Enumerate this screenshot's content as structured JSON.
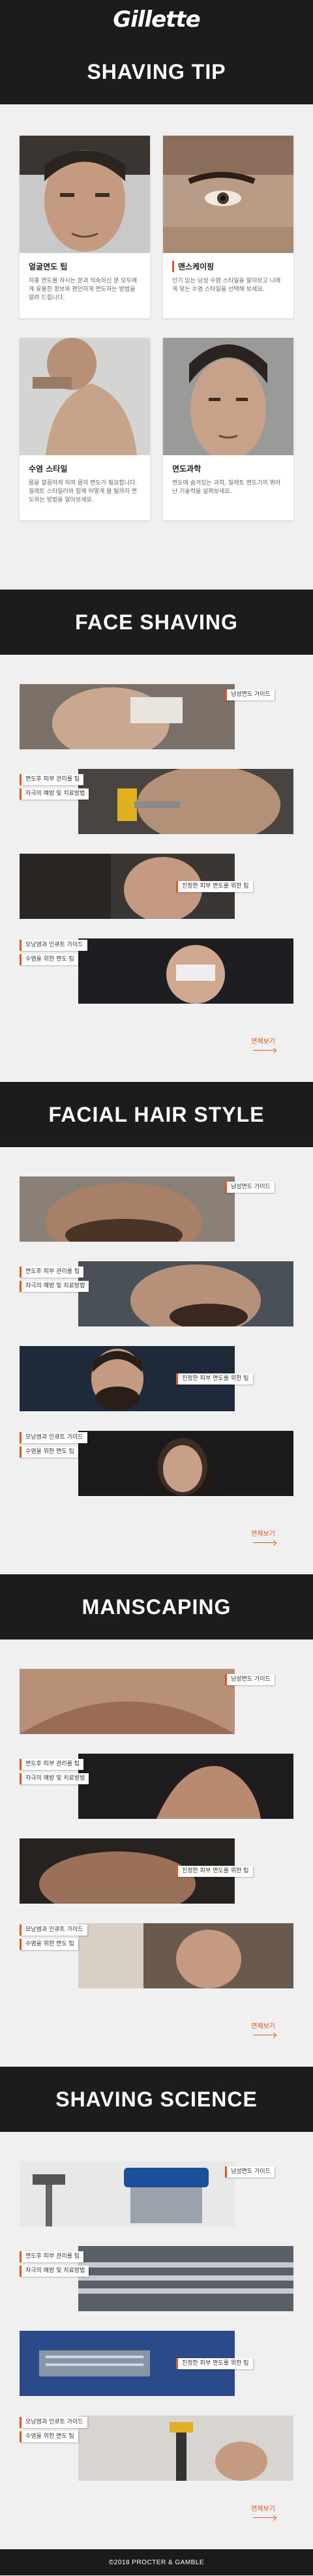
{
  "header": {
    "logo": "Gillette"
  },
  "tip_section": {
    "title": "SHAVING TIP",
    "cards": [
      {
        "title": "얼굴면도 팁",
        "desc": "차홍 면도를 하시는 분과 익숙하신 분 모두에게 유용한 정보와 편안하게 면도하는 방법을 알려 드립니다."
      },
      {
        "title": "맨스케이핑",
        "desc": "인기 있는 남성 수염 스타일을 알아보고 나에게 맞는 수염 스타일을 선택해 보세요."
      },
      {
        "title": "수염 스타일",
        "desc": "몸을 깔끔하게 하며 몸의 면도가 필요합니다. 질레트 스타일러와 함께 어떻게 몸 털까지 면도하는 방법을 알아보세요."
      },
      {
        "title": "면도과학",
        "desc": "면도에 숨겨있는 과학, 질레트 면도기의 뛰어난 기술력을 살펴보세요."
      }
    ]
  },
  "sections": [
    {
      "title": "FACE SHAVING",
      "items": [
        {
          "label": "남성면도 가이드"
        },
        {
          "label": "면도후 피부 관리를 팁",
          "sub": "자극의 예방 및 치료방법"
        },
        {
          "label": "진정한 피부 면도를 위한 팁"
        },
        {
          "label": "모낭염과 인큐트 가이드",
          "sub": "수염을 위한 면도 팁"
        }
      ],
      "more": "면체보기"
    },
    {
      "title": "FACIAL HAIR STYLE",
      "items": [
        {
          "label": "남성면도 가이드"
        },
        {
          "label": "면도후 피부 관리를 팁",
          "sub": "자극의 예방 및 치료방법"
        },
        {
          "label": "진정한 피부 면도를 위한 팁"
        },
        {
          "label": "모낭염과 인큐트 가이드",
          "sub": "수염을 위한 면도 팁"
        }
      ],
      "more": "면체보기"
    },
    {
      "title": "MANSCAPING",
      "items": [
        {
          "label": "남성면도 가이드"
        },
        {
          "label": "면도후 피부 관리를 팁",
          "sub": "자극의 예방 및 치료방법"
        },
        {
          "label": "진정한 피부 면도를 위한 팁"
        },
        {
          "label": "모낭염과 인큐트 가이드",
          "sub": "수염을 위한 면도 팁"
        }
      ],
      "more": "면체보기"
    },
    {
      "title": "SHAVING SCIENCE",
      "items": [
        {
          "label": "남성면도 가이드"
        },
        {
          "label": "면도후 피부 관리를 팁",
          "sub": "자극의 예방 및 치료방법"
        },
        {
          "label": "진정한 피부 면도를 위한 팁"
        },
        {
          "label": "모낭염과 인큐트 가이드",
          "sub": "수염을 위한 면도 팁"
        }
      ],
      "more": "면체보기"
    }
  ],
  "footer": {
    "text": "©2018 PROCTER & GAMBLE"
  },
  "colors": {
    "accent": "#e2571d",
    "dark": "#1b1b1b",
    "bg": "#f0f0f0"
  }
}
